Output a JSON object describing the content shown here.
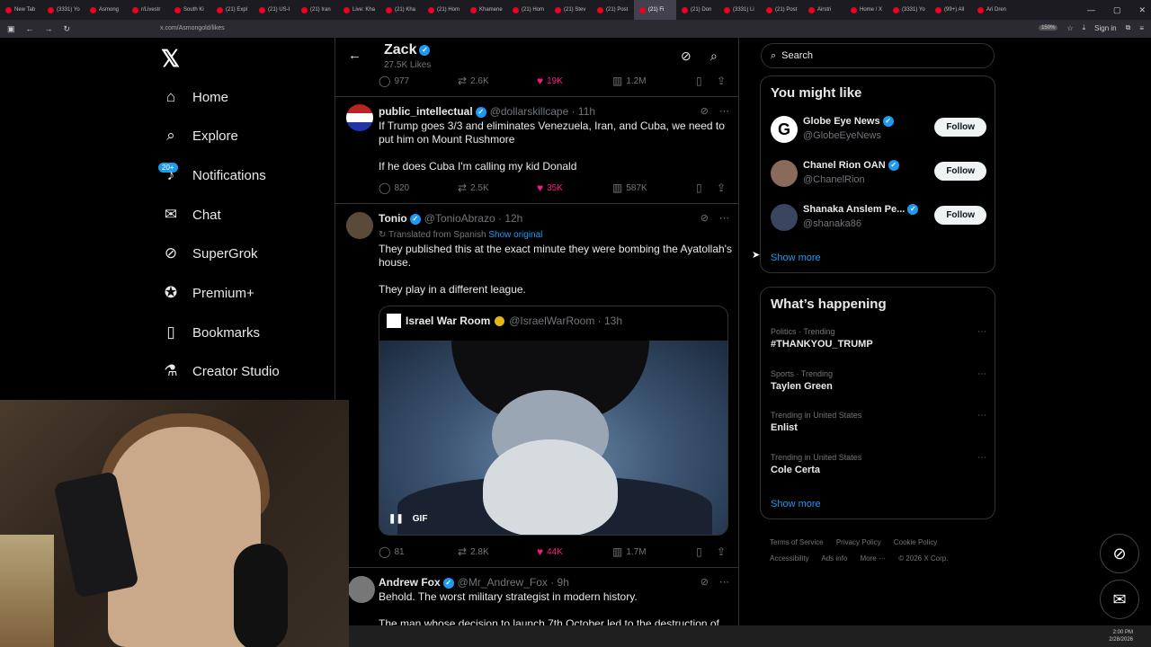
{
  "browser": {
    "tabs": [
      "New Tab",
      "(3331) Yo",
      "Asmong",
      "r/Livestr",
      "South Ki",
      "(21) Expl",
      "(21) US-I",
      "(21) Iran",
      "Live: Kha",
      "(21) Kha",
      "(21) Hom",
      "Khamene",
      "(21) Hom",
      "(21) Stev",
      "(21) Post",
      "(21) Fi",
      "(21) Don",
      "(3331) Li",
      "(21) Post",
      "Airstri",
      "Home / X",
      "(3331) Yo",
      "(99+) All",
      "Ari Dren"
    ],
    "url": "x.com/Asmongold/likes",
    "zoom": "150%",
    "signin": "Sign in"
  },
  "nav": {
    "items": [
      {
        "label": "Home",
        "icon": "home-icon"
      },
      {
        "label": "Explore",
        "icon": "search-icon"
      },
      {
        "label": "Notifications",
        "icon": "bell-icon"
      },
      {
        "label": "Chat",
        "icon": "mail-icon"
      },
      {
        "label": "SuperGrok",
        "icon": "grok-icon"
      },
      {
        "label": "Premium+",
        "icon": "premium-icon"
      },
      {
        "label": "Bookmarks",
        "icon": "bookmark-icon"
      },
      {
        "label": "Creator Studio",
        "icon": "flask-icon"
      }
    ],
    "notif_badge": "20+"
  },
  "header": {
    "name": "Zack",
    "sub": "27.5K Likes"
  },
  "top_post_stats": {
    "replies": "977",
    "reposts": "2.6K",
    "likes": "19K",
    "views": "1.2M"
  },
  "posts": [
    {
      "name": "public_intellectual",
      "handle": "@dollarskillcape · 11h",
      "text1": "If Trump goes 3/3 and eliminates Venezuela, Iran, and Cuba, we need to put him on Mount Rushmore",
      "text2": "If he does Cuba I'm calling my kid Donald",
      "replies": "820",
      "reposts": "2.5K",
      "likes": "35K",
      "views": "587K"
    },
    {
      "name": "Tonio",
      "handle": "@TonioAbrazo · 12h",
      "translated": "Translated from Spanish",
      "show_original": "Show original",
      "text1": "They published this at the exact minute they were bombing the Ayatollah's house.",
      "text2": "They play in a different league.",
      "quote_name": "Israel War Room",
      "quote_handle": "@IsraelWarRoom · 13h",
      "gif_label": "GIF",
      "replies": "81",
      "reposts": "2.8K",
      "likes": "44K",
      "views": "1.7M"
    },
    {
      "name": "Andrew Fox",
      "handle": "@Mr_Andrew_Fox · 9h",
      "text1": "Behold. The worst military strategist in modern history.",
      "text2": "The man whose decision to launch 7th October led to the destruction of"
    }
  ],
  "search": {
    "placeholder": "Search"
  },
  "you_might_like": {
    "title": "You might like",
    "accounts": [
      {
        "name": "Globe Eye News",
        "handle": "@GlobeEyeNews"
      },
      {
        "name": "Chanel Rion OAN",
        "handle": "@ChanelRion"
      },
      {
        "name": "Shanaka Anslem Pe...",
        "handle": "@shanaka86"
      }
    ],
    "follow_label": "Follow",
    "show_more": "Show more"
  },
  "whats_happening": {
    "title": "What’s happening",
    "trends": [
      {
        "context": "Politics · Trending",
        "topic": "#THANKYOU_TRUMP"
      },
      {
        "context": "Sports · Trending",
        "topic": "Taylen Green"
      },
      {
        "context": "Trending in United States",
        "topic": "Enlist"
      },
      {
        "context": "Trending in United States",
        "topic": "Cole Certa"
      }
    ],
    "show_more": "Show more"
  },
  "footer": {
    "links": [
      "Terms of Service",
      "Privacy Policy",
      "Cookie Policy",
      "Accessibility",
      "Ads info",
      "More ···",
      "© 2026 X Corp."
    ]
  },
  "clock": {
    "time": "2:00 PM",
    "date": "2/28/2026"
  },
  "colors": {
    "accent": "#1d9bf0",
    "like": "#f91880",
    "bg": "#000000"
  }
}
